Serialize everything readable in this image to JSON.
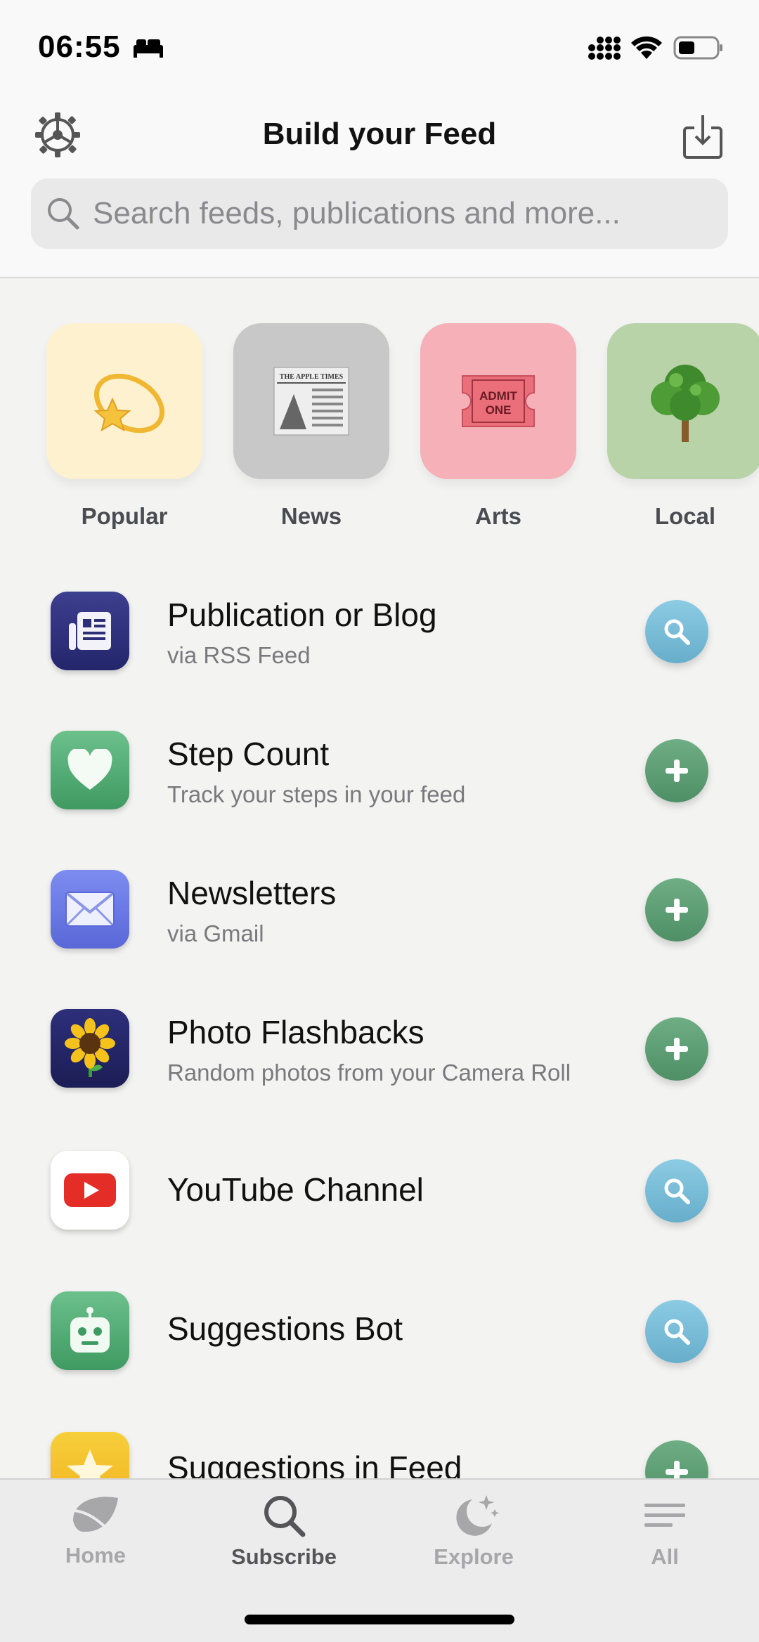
{
  "status_bar": {
    "time": "06:55"
  },
  "header": {
    "title": "Build your Feed",
    "search_placeholder": "Search feeds, publications and more..."
  },
  "categories": [
    {
      "label": "Popular",
      "bg": "#fdf1cf",
      "icon": "shooting-star-icon"
    },
    {
      "label": "News",
      "bg": "#c8c8c8",
      "icon": "newspaper-icon"
    },
    {
      "label": "Arts",
      "bg": "#f5b0b8",
      "icon": "ticket-icon"
    },
    {
      "label": "Local",
      "bg": "#b9d3a9",
      "icon": "tree-icon"
    }
  ],
  "newspaper": {
    "masthead": "THE APPLE TIMES"
  },
  "ticket": {
    "line1": "ADMIT",
    "line2": "ONE"
  },
  "feed_items": [
    {
      "title": "Publication or Blog",
      "subtitle": "via RSS Feed",
      "action": "search",
      "icon": "rss-reader-icon"
    },
    {
      "title": "Step Count",
      "subtitle": "Track your steps in your feed",
      "action": "add",
      "icon": "heart-icon"
    },
    {
      "title": "Newsletters",
      "subtitle": "via Gmail",
      "action": "add",
      "icon": "envelope-icon"
    },
    {
      "title": "Photo Flashbacks",
      "subtitle": "Random photos from your Camera Roll",
      "action": "add",
      "icon": "sunflower-icon"
    },
    {
      "title": "YouTube Channel",
      "subtitle": "",
      "action": "search",
      "icon": "youtube-icon"
    },
    {
      "title": "Suggestions Bot",
      "subtitle": "",
      "action": "search",
      "icon": "robot-icon"
    },
    {
      "title": "Suggestions in Feed",
      "subtitle": "",
      "action": "add",
      "icon": "star-icon"
    }
  ],
  "tabs": [
    {
      "label": "Home",
      "icon": "leaf-icon",
      "active": false
    },
    {
      "label": "Subscribe",
      "icon": "search-icon",
      "active": true
    },
    {
      "label": "Explore",
      "icon": "moon-stars-icon",
      "active": false
    },
    {
      "label": "All",
      "icon": "list-icon",
      "active": false
    }
  ],
  "colors": {
    "add_button": "#5b9b72",
    "search_button": "#79bcd6",
    "accent_text": "#555558"
  }
}
